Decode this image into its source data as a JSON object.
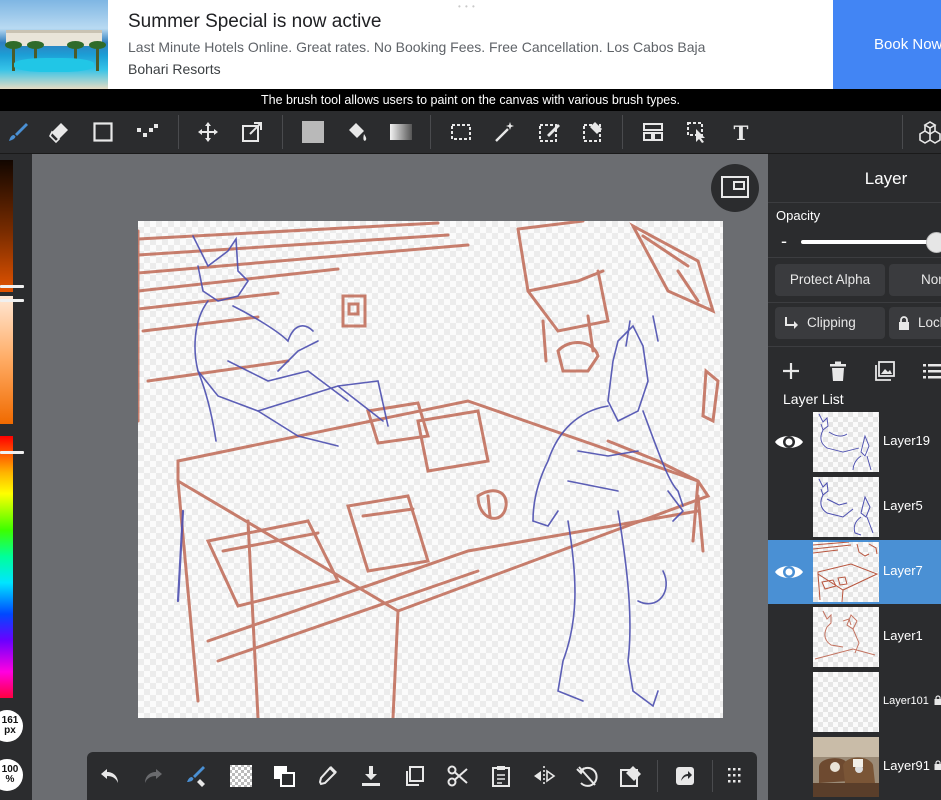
{
  "ad": {
    "title": "Summer Special is now active",
    "description": "Last Minute Hotels Online. Great rates. No Booking Fees. Free Cancellation. Los Cabos Baja",
    "advertiser": "Bohari Resorts",
    "cta": "Book Now",
    "cta_color": "#4285f4"
  },
  "tooltip": "The brush tool allows users to paint on the canvas with various brush types.",
  "toolbar": {
    "tools": [
      "brush-icon",
      "eraser-icon",
      "rectangle-icon",
      "dot-pattern-icon",
      "move-icon",
      "transform-icon",
      "fill-color-swatch-icon",
      "bucket-icon",
      "gradient-icon",
      "select-rectangle-icon",
      "magic-wand-icon",
      "select-pen-icon",
      "select-eraser-icon",
      "layout-icon",
      "operation-icon",
      "text-icon",
      "material-icon"
    ],
    "active_tool": "brush-icon",
    "accent_color": "#4a90d4"
  },
  "colorbar": {
    "brush_size": "161",
    "brush_size_unit": "px",
    "opacity": "100",
    "opacity_unit": "%"
  },
  "bottombar": {
    "tools": [
      "undo-icon",
      "redo-icon",
      "brush-eraser-icon",
      "transparent-icon",
      "color-swap-icon",
      "eyedropper-icon",
      "download-icon",
      "copy-icon",
      "cut-icon",
      "paste-icon",
      "flip-icon",
      "rotate-icon",
      "clear-icon",
      "share-icon",
      "grid-menu-icon"
    ]
  },
  "layer_panel": {
    "title": "Layer",
    "opacity_label": "Opacity",
    "opacity_minus": "-",
    "opacity_value": 0.9,
    "protect_alpha": "Protect Alpha",
    "blend_mode": "Normal",
    "clipping": "Clipping",
    "lock_label": "Lock",
    "layer_list_title": "Layer List",
    "selected_color": "#4a90d4",
    "layers": [
      {
        "name": "Layer19",
        "visible": true,
        "selected": false,
        "locked": false
      },
      {
        "name": "Layer5",
        "visible": false,
        "selected": false,
        "locked": false
      },
      {
        "name": "Layer7",
        "visible": true,
        "selected": true,
        "locked": false
      },
      {
        "name": "Layer1",
        "visible": false,
        "selected": false,
        "locked": false
      },
      {
        "name": "Layer101",
        "visible": false,
        "selected": false,
        "locked": true
      },
      {
        "name": "Layer91",
        "visible": false,
        "selected": false,
        "locked": true
      }
    ]
  }
}
